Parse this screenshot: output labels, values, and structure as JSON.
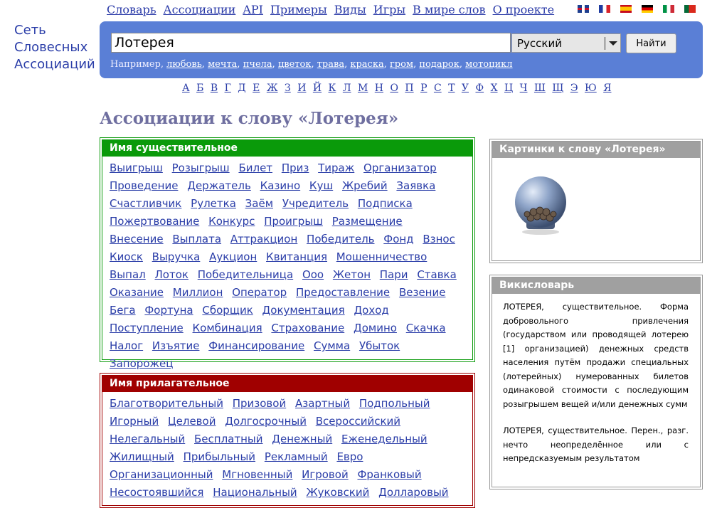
{
  "topnav": [
    "Словарь",
    "Ассоциации",
    "API",
    "Примеры",
    "Виды",
    "Игры",
    "В мире слов",
    "О проекте"
  ],
  "flags": [
    "en",
    "fr",
    "es",
    "de",
    "it",
    "pt",
    "ru"
  ],
  "logo": [
    "Сеть",
    "Словесных",
    "Ассоциаций"
  ],
  "search": {
    "value": "Лотерея",
    "language": "Русский",
    "button": "Найти",
    "examples_label": "Например,",
    "examples": [
      "любовь",
      "мечта",
      "пчела",
      "цветок",
      "трава",
      "краска",
      "гром",
      "подарок",
      "мотоцикл"
    ]
  },
  "alphabet": [
    "А",
    "Б",
    "В",
    "Г",
    "Д",
    "Е",
    "Ж",
    "З",
    "И",
    "Й",
    "К",
    "Л",
    "М",
    "Н",
    "О",
    "П",
    "Р",
    "С",
    "Т",
    "У",
    "Ф",
    "Х",
    "Ц",
    "Ч",
    "Ш",
    "Щ",
    "Э",
    "Ю",
    "Я"
  ],
  "page_title": "Ассоциации к слову «Лотерея»",
  "nouns": {
    "title": "Имя существительное",
    "words": [
      "Выигрыш",
      "Розыгрыш",
      "Билет",
      "Приз",
      "Тираж",
      "Организатор",
      "Проведение",
      "Держатель",
      "Казино",
      "Куш",
      "Жребий",
      "Заявка",
      "Счастливчик",
      "Рулетка",
      "Заём",
      "Учредитель",
      "Подписка",
      "Пожертвование",
      "Конкурс",
      "Проигрыш",
      "Размещение",
      "Внесение",
      "Выплата",
      "Аттракцион",
      "Победитель",
      "Фонд",
      "Взнос",
      "Киоск",
      "Выручка",
      "Аукцион",
      "Квитанция",
      "Мошенничество",
      "Выпал",
      "Лоток",
      "Победительница",
      "Ооо",
      "Жетон",
      "Пари",
      "Ставка",
      "Оказание",
      "Миллион",
      "Оператор",
      "Предоставление",
      "Везение",
      "Бега",
      "Фортуна",
      "Сборщик",
      "Документация",
      "Доход",
      "Поступление",
      "Комбинация",
      "Страхование",
      "Домино",
      "Скачка",
      "Налог",
      "Изъятие",
      "Финансирование",
      "Сумма",
      "Убыток",
      "Запорожец"
    ]
  },
  "adjectives": {
    "title": "Имя прилагательное",
    "words": [
      "Благотворительный",
      "Призовой",
      "Азартный",
      "Подпольный",
      "Игорный",
      "Целевой",
      "Долгосрочный",
      "Всероссийский",
      "Нелегальный",
      "Бесплатный",
      "Денежный",
      "Еженедельный",
      "Жилищный",
      "Прибыльный",
      "Рекламный",
      "Евро",
      "Организационный",
      "Мгновенный",
      "Игровой",
      "Франковый",
      "Несостоявшийся",
      "Национальный",
      "Жуковский",
      "Долларовый"
    ]
  },
  "pictures": {
    "title": "Картинки к слову «Лотерея»"
  },
  "wiki": {
    "title": "Викисловарь",
    "entries": [
      "ЛОТЕРЕЯ, существительное. Форма добровольного привлечения (государством или проводящей лотерею [1] организацией) денежных средств населения путём продажи специальных (лотерейных) нумерованных билетов одинаковой стоимости с последующим розыгрышем вещей и/или денежных сумм",
      "ЛОТЕРЕЯ, существительное. Перен., разг. нечто неопределённое или с непредсказуемым результатом"
    ]
  },
  "colors": {
    "search_bg": "#5a7fd6",
    "nouns_header": "#0a9a0a",
    "adjectives_header": "#a00000",
    "side_header": "#a0a0a0",
    "title": "#6f6fa0",
    "link": "#2a3da8"
  }
}
